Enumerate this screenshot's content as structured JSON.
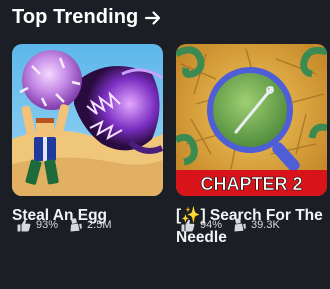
{
  "section": {
    "title": "Top Trending"
  },
  "games": [
    {
      "title": "Steal An Egg",
      "rating": "93%",
      "players": "2.5M"
    },
    {
      "title": "[✨] Search For The Needle",
      "banner": "CHAPTER 2",
      "rating": "94%",
      "players": "39.3K"
    }
  ],
  "icons": {
    "rating": "thumbs-up-icon",
    "players": "player-count-icon",
    "see_all": "arrow-right-icon"
  },
  "colors": {
    "background": "#1b1e24",
    "text": "#ffffff",
    "stats_text": "#d7d9dd",
    "banner_red": "#d8141a"
  }
}
